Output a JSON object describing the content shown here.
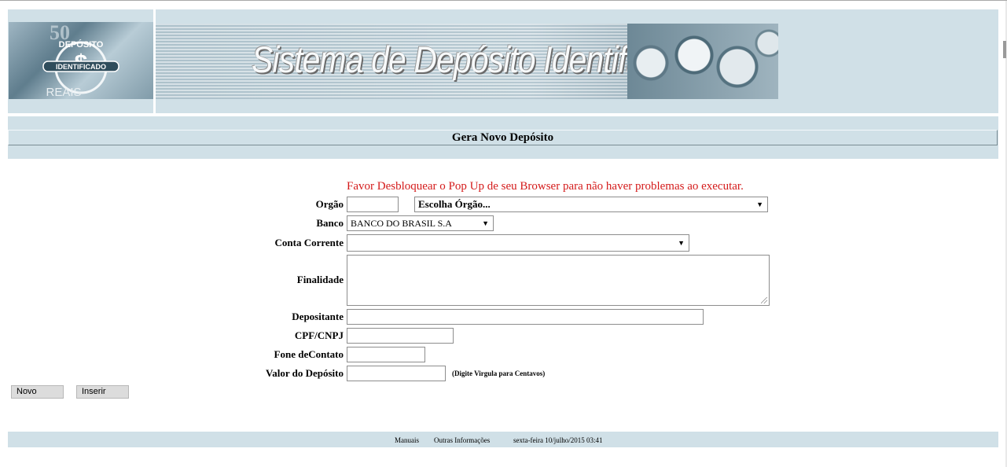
{
  "header": {
    "banner_title": "Sistema de Depósito Identificado",
    "logo_text_top": "DEPÓSITO",
    "logo_text_mid": "IDENTIFICADO",
    "logo_text_bottom": "REAIS",
    "logo_number": "50"
  },
  "page_title": "Gera Novo Depósito",
  "warning": "Favor Desbloquear o Pop Up de seu Browser para não haver problemas ao executar.",
  "form": {
    "orgao_label": "Orgão",
    "orgao_code_value": "",
    "orgao_select_value": "Escolha Órgão...",
    "banco_label": "Banco",
    "banco_select_value": "BANCO DO BRASIL S.A",
    "conta_label": "Conta Corrente",
    "conta_select_value": "",
    "finalidade_label": "Finalidade",
    "finalidade_value": "",
    "depositante_label": "Depositante",
    "depositante_value": "",
    "cpf_label": "CPF/CNPJ",
    "cpf_value": "",
    "fone_label": "Fone deContato",
    "fone_value": "",
    "valor_label": "Valor do Depósito",
    "valor_value": "",
    "valor_hint": "(Digite Virgula para Centavos)"
  },
  "buttons": {
    "novo": "Novo",
    "inserir": "Inserir"
  },
  "footer": {
    "manuais": "Manuais",
    "outras": "Outras Informações",
    "datetime": "sexta-feira 10/julho/2015 03:41"
  },
  "icons": {
    "dropdown": "triangle-down-icon",
    "resize": "resize-grip-icon"
  }
}
